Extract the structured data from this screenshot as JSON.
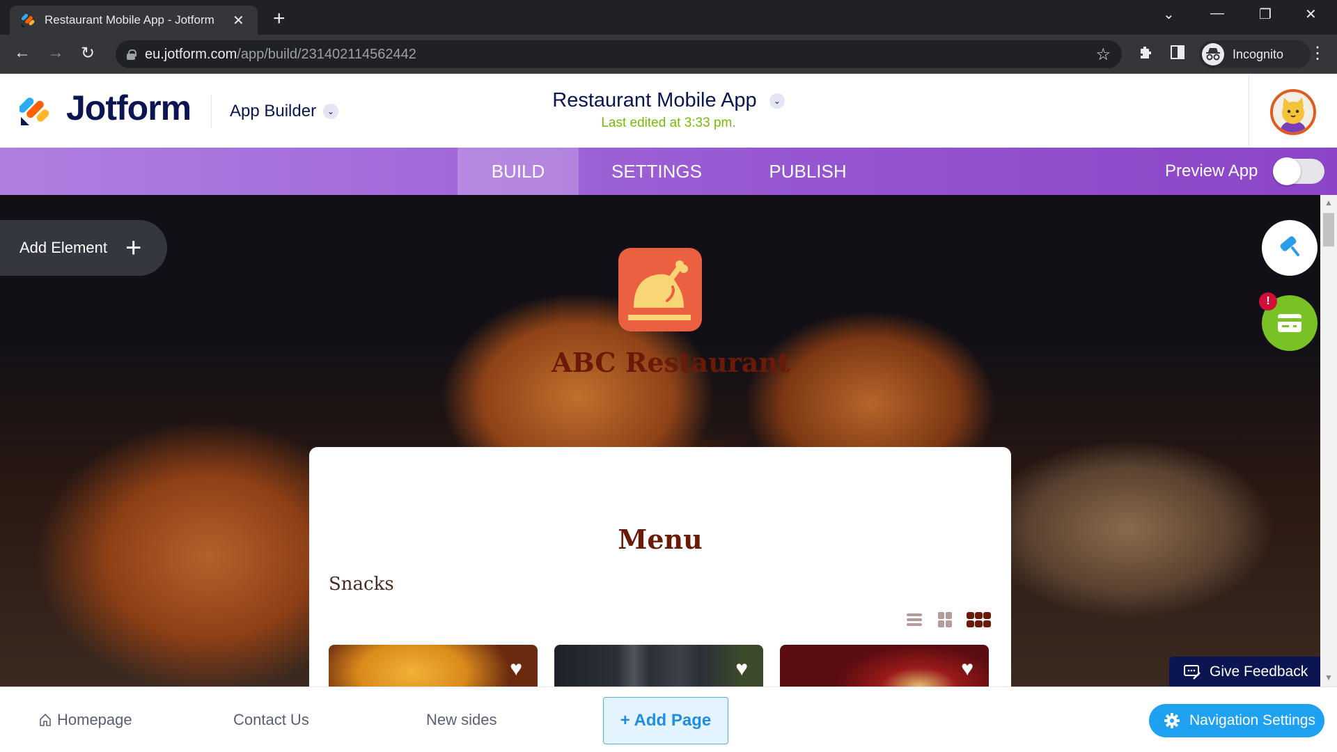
{
  "browser": {
    "tab_title": "Restaurant Mobile App - Jotform",
    "url_host": "eu.jotform.com",
    "url_path": "/app/build/231402114562442",
    "profile_label": "Incognito"
  },
  "header": {
    "logo_text": "Jotform",
    "product_menu": "App Builder",
    "app_title": "Restaurant Mobile App",
    "last_edited": "Last edited at 3:33 pm."
  },
  "nav": {
    "tabs": [
      {
        "label": "BUILD",
        "active": true
      },
      {
        "label": "SETTINGS",
        "active": false
      },
      {
        "label": "PUBLISH",
        "active": false
      }
    ],
    "preview_label": "Preview App",
    "preview_enabled": false
  },
  "canvas": {
    "add_element_label": "Add Element",
    "restaurant_name": "ABC Restaurant",
    "menu_title": "Menu",
    "section_title": "Snacks",
    "view_modes": [
      "list",
      "grid-2",
      "grid-3"
    ],
    "active_view": "grid-3",
    "products": [
      {
        "image": "snack-image-1",
        "favorite": false
      },
      {
        "image": "snack-image-2",
        "favorite": false
      },
      {
        "image": "snack-image-3",
        "favorite": false
      }
    ],
    "notification_badge": "!",
    "feedback_label": "Give Feedback"
  },
  "bottom": {
    "pages": [
      {
        "label": "Homepage",
        "icon": "home-icon"
      },
      {
        "label": "Contact Us"
      },
      {
        "label": "New sides"
      }
    ],
    "add_page_label": "+ Add Page",
    "nav_settings_label": "Navigation Settings"
  },
  "colors": {
    "brand_navy": "#0a1551",
    "nav_purple": "#9656d1",
    "accent_blue": "#1ea1f1",
    "edited_green": "#78bb07",
    "restaurant_brown": "#6b1a08",
    "icon_orange": "#ec6042"
  }
}
